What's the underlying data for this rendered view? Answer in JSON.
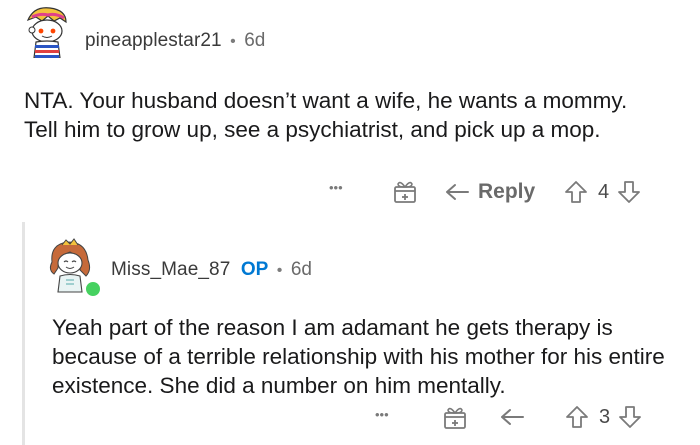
{
  "comments": [
    {
      "username": "pineapplestar21",
      "separator": "•",
      "age": "6d",
      "text": "NTA. Your husband doesn’t want a wife, he wants a mommy. Tell him to grow up, see a psychiatrist, and pick up a mop.",
      "actions": {
        "more": "•••",
        "reply_label": "Reply",
        "score": "4"
      }
    },
    {
      "username": "Miss_Mae_87",
      "op_badge": "OP",
      "separator": "•",
      "age": "6d",
      "text": "Yeah part of the reason I am adamant he gets therapy is because of a terrible relationship with his mother for his entire existence. She did a number on him mentally.",
      "actions": {
        "more": "•••",
        "score": "3"
      }
    }
  ],
  "icons": [
    "avatar",
    "more-icon",
    "award-gift-icon",
    "reply-arrow-icon",
    "upvote-icon",
    "downvote-icon",
    "online-status-dot"
  ],
  "colors": {
    "op_badge": "#0079d3",
    "online": "#46d160",
    "icon_gray": "#7a7a7a"
  }
}
